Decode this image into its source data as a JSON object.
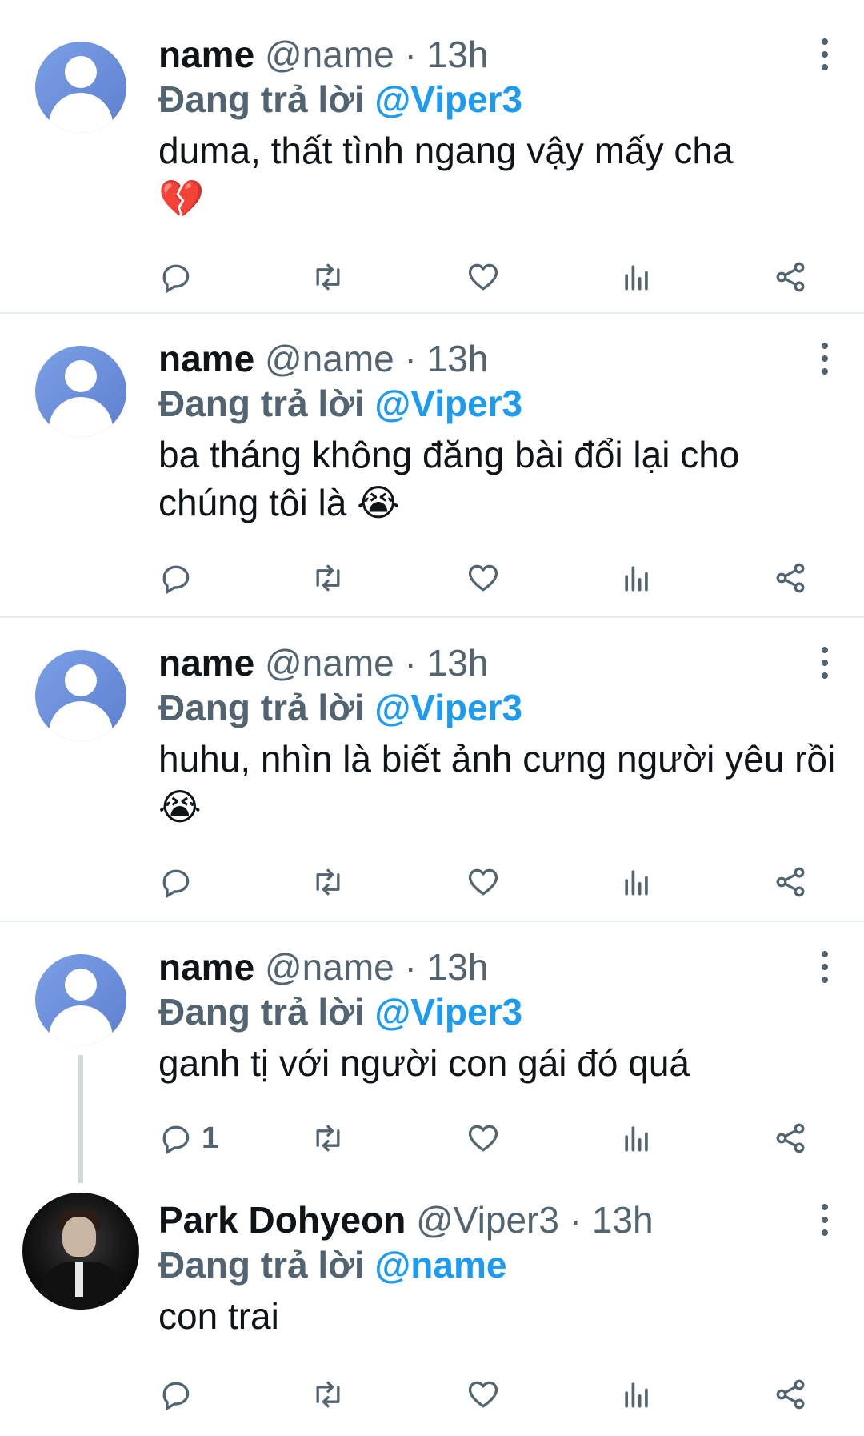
{
  "tweets": [
    {
      "name": "name",
      "handle": "@name",
      "dot": "·",
      "time": "13h",
      "reply_prefix": "Đang trả lời",
      "reply_to": "@Viper3",
      "text": "duma, thất tình ngang vậy mấy cha",
      "emoji": "💔",
      "reply_count": ""
    },
    {
      "name": "name",
      "handle": "@name",
      "dot": "·",
      "time": "13h",
      "reply_prefix": "Đang trả lời",
      "reply_to": "@Viper3",
      "text": "ba tháng không đăng bài đổi lại cho chúng tôi là",
      "emoji": "😭",
      "reply_count": ""
    },
    {
      "name": "name",
      "handle": "@name",
      "dot": "·",
      "time": "13h",
      "reply_prefix": "Đang trả lời",
      "reply_to": "@Viper3",
      "text": "huhu, nhìn là biết ảnh cưng người yêu rồi",
      "emoji": "😭",
      "reply_count": ""
    },
    {
      "name": "name",
      "handle": "@name",
      "dot": "·",
      "time": "13h",
      "reply_prefix": "Đang trả lời",
      "reply_to": "@Viper3",
      "text": "ganh tị với người con gái đó quá",
      "emoji": "",
      "reply_count": "1"
    },
    {
      "name": "Park Dohyeon",
      "handle": "@Viper3",
      "dot": "·",
      "time": "13h",
      "reply_prefix": "Đang trả lời",
      "reply_to": "@name",
      "text": "con trai",
      "emoji": "",
      "reply_count": ""
    }
  ],
  "icons": {
    "reply": "reply-icon",
    "retweet": "retweet-icon",
    "like": "heart-icon",
    "analytics": "analytics-icon",
    "share": "share-icon",
    "more": "more-vertical-icon"
  },
  "colors": {
    "text": "#0f1419",
    "secondary": "#536471",
    "mention": "#1d9bf0",
    "divider": "#e6ecf0"
  }
}
